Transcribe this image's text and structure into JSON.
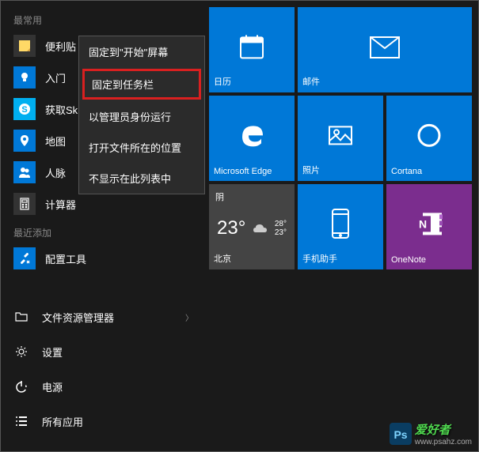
{
  "sections": {
    "most_used": "最常用",
    "recently_added": "最近添加"
  },
  "apps": {
    "sticky_notes": "便利贴",
    "getting_started": "入门",
    "skype": "获取Sk",
    "maps": "地图",
    "people": "人脉",
    "calculator": "计算器",
    "config_tool": "配置工具"
  },
  "bottom": {
    "file_explorer": "文件资源管理器",
    "settings": "设置",
    "power": "电源",
    "all_apps": "所有应用"
  },
  "tiles": {
    "calendar": "日历",
    "mail": "邮件",
    "edge": "Microsoft Edge",
    "photos": "照片",
    "cortana": "Cortana",
    "phone_companion": "手机助手",
    "onenote": "OneNote"
  },
  "weather": {
    "condition": "阴",
    "temp": "23°",
    "high": "28°",
    "low": "23°",
    "city": "北京"
  },
  "context_menu": {
    "pin_start": "固定到\"开始\"屏幕",
    "pin_taskbar": "固定到任务栏",
    "run_admin": "以管理员身份运行",
    "open_location": "打开文件所在的位置",
    "remove_list": "不显示在此列表中"
  },
  "watermark": {
    "text": "爱好者",
    "url": "www.psahz.com"
  }
}
